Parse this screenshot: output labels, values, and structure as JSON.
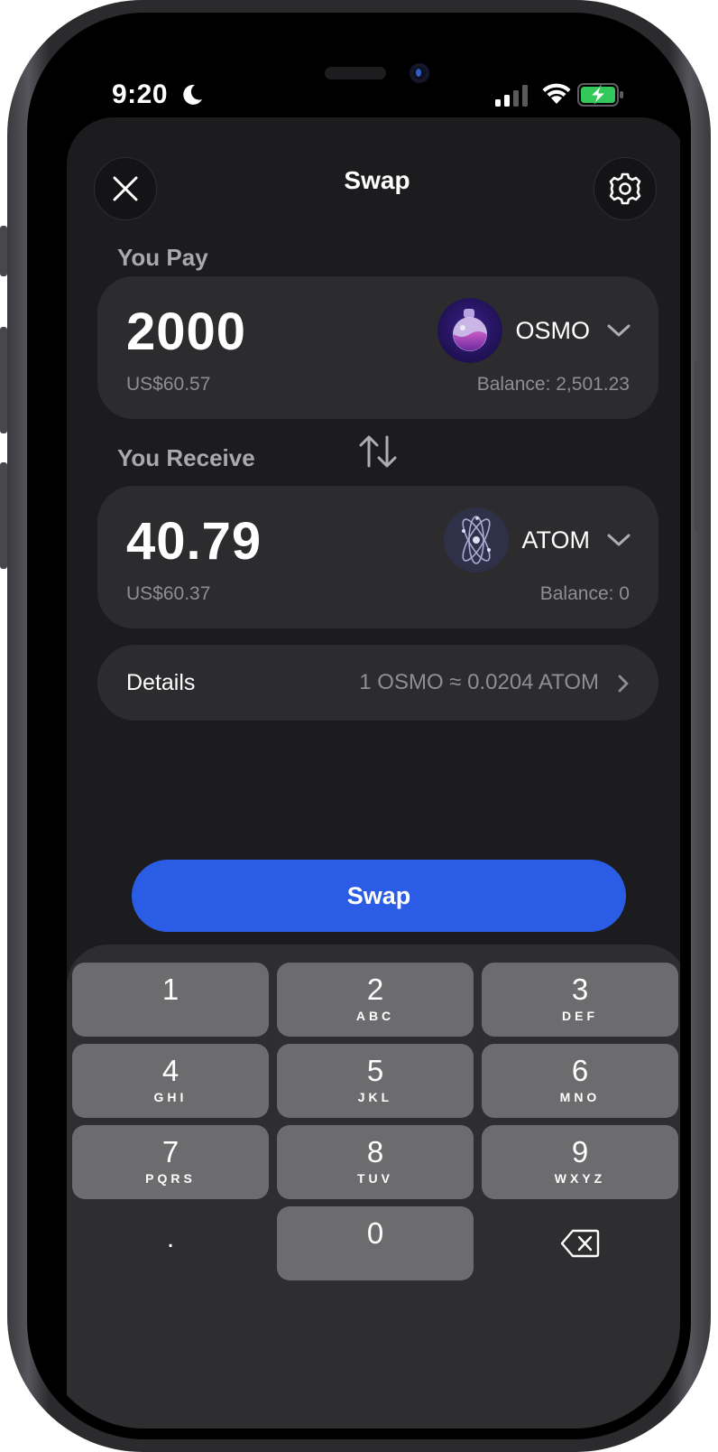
{
  "status_bar": {
    "time": "9:20",
    "icons": [
      "moon-icon",
      "signal-icon",
      "wifi-icon",
      "battery-charging-icon"
    ]
  },
  "header": {
    "title": "Swap",
    "close_icon": "close-icon",
    "settings_icon": "gear-icon"
  },
  "pay": {
    "label": "You Pay",
    "amount": "2000",
    "fiat": "US$60.57",
    "token": "OSMO",
    "balance": "Balance: 2,501.23"
  },
  "receive": {
    "label": "You Receive",
    "amount": "40.79",
    "fiat": "US$60.37",
    "token": "ATOM",
    "balance": "Balance: 0"
  },
  "details": {
    "label": "Details",
    "rate": "1 OSMO ≈ 0.0204 ATOM"
  },
  "swap_button": {
    "label": "Swap"
  },
  "keypad": {
    "keys": [
      {
        "num": "1",
        "letters": ""
      },
      {
        "num": "2",
        "letters": "ABC"
      },
      {
        "num": "3",
        "letters": "DEF"
      },
      {
        "num": "4",
        "letters": "GHI"
      },
      {
        "num": "5",
        "letters": "JKL"
      },
      {
        "num": "6",
        "letters": "MNO"
      },
      {
        "num": "7",
        "letters": "PQRS"
      },
      {
        "num": "8",
        "letters": "TUV"
      },
      {
        "num": "9",
        "letters": "WXYZ"
      },
      {
        "num": ".",
        "letters": ""
      },
      {
        "num": "0",
        "letters": ""
      }
    ]
  },
  "colors": {
    "accent": "#2b5ce6",
    "sheet": "#1c1c1e",
    "card": "#2c2c2f",
    "key": "#6c6c6e",
    "battery": "#34c759"
  }
}
